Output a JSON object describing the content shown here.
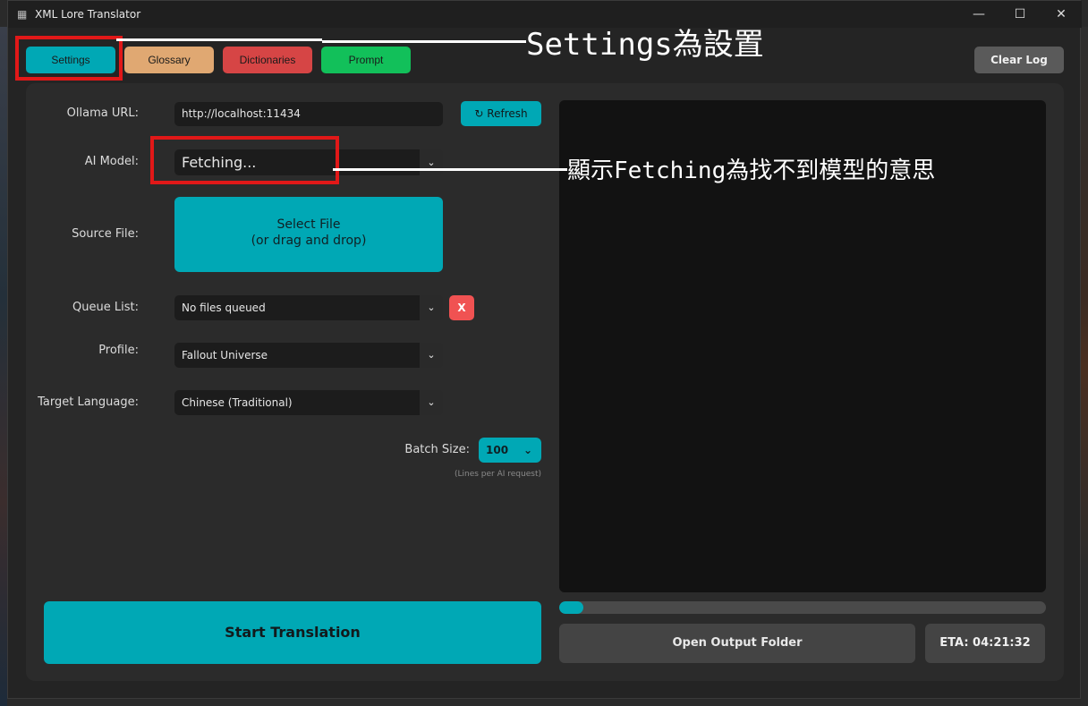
{
  "window": {
    "title": "XML Lore Translator",
    "icon": "app-grid-icon"
  },
  "window_controls": [
    "—",
    "☐",
    "✕"
  ],
  "tabs": [
    {
      "label": "Settings",
      "color": "#00a8b5",
      "active": true
    },
    {
      "label": "Glossary",
      "color": "#e0a872"
    },
    {
      "label": "Dictionaries",
      "color": "#d64545"
    },
    {
      "label": "Prompt",
      "color": "#12c05a"
    }
  ],
  "clear_log": "Clear Log",
  "settings": {
    "ollama_url_label": "Ollama URL:",
    "ollama_url_value": "http://localhost:11434",
    "refresh_label": "Refresh",
    "refresh_icon": "↻",
    "ai_model_label": "AI Model:",
    "ai_model_value": "Fetching...",
    "source_file_label": "Source File:",
    "select_file_line1": "Select File",
    "select_file_line2": "(or drag and drop)",
    "queue_label": "Queue List:",
    "queue_value": "No files queued",
    "queue_clear": "X",
    "profile_label": "Profile:",
    "profile_value": "Fallout Universe",
    "target_lang_label": "Target Language:",
    "target_lang_value": "Chinese (Traditional)",
    "batch_label": "Batch Size:",
    "batch_value": "100",
    "batch_hint": "(Lines per AI request)"
  },
  "start_translation": "Start Translation",
  "progress": {
    "fraction": 0.05
  },
  "open_output_folder": "Open Output Folder",
  "eta": "ETA: 04:21:32",
  "annotations": {
    "settings_note": "Settings為設置",
    "fetching_note": "顯示Fetching為找不到模型的意思"
  },
  "colors": {
    "accent": "#00a8b5",
    "annotation_box": "#e11818"
  }
}
